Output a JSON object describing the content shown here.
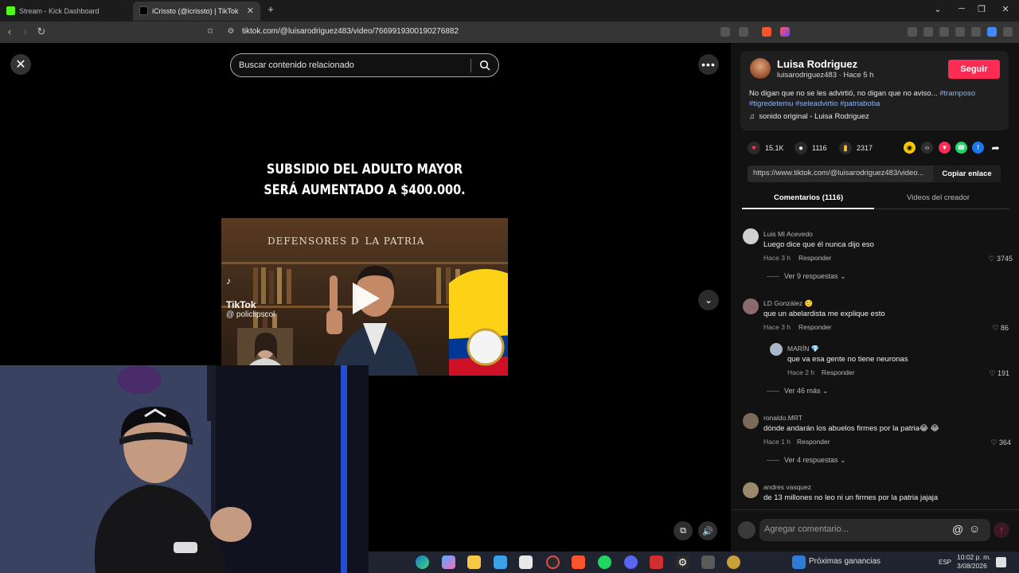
{
  "browser": {
    "tabs": [
      {
        "title": "Stream - Kick Dashboard",
        "favicon_color": "#53fc18"
      },
      {
        "title": "iCrissto (@icrissto) | TikTok",
        "close": "✕"
      }
    ],
    "new_tab": "+",
    "window_controls": {
      "minimize": "─",
      "restore": "❐",
      "close": "✕",
      "chevron": "⌄"
    },
    "nav": {
      "back": "‹",
      "forward": "›",
      "reload": "↻"
    },
    "url": "tiktok.com/@luisarodriguez483/video/7669919300190276882"
  },
  "video": {
    "search_placeholder": "Buscar contenido relacionado",
    "headline_line1": "SUBSIDIO DEL ADULTO MAYOR",
    "headline_line2": "SERÁ AUMENTADO A $400.000.",
    "clip_banner": "DEFENSORES D LA PATRIA",
    "watermark_logo": "♪",
    "watermark_name": "TikTok",
    "watermark_handle": "@ policlipscol",
    "close_icon": "✕",
    "more_icon": "•••",
    "down_icon": "⌄",
    "controls": {
      "pip": "⧉",
      "volume": "🔊"
    }
  },
  "taskbar": {
    "earnings": "Próximas ganancias",
    "lang": "ESP",
    "time": "10:02 p. m.",
    "date": "3/08/2026"
  },
  "author": {
    "name": "Luisa Rodriguez",
    "meta": "luisarodriguez483 · Hace 5 h",
    "follow": "Seguir",
    "description": "No digan que no se les advirtió, no digan que no aviso...",
    "tags": [
      "#tramposo",
      "#tigredetemu",
      "#seleadvirtio",
      "#patriaboba"
    ],
    "sound": "sonido original - Luisa Rodriguez",
    "sound_icon": "♫"
  },
  "stats": {
    "likes": "15.1K",
    "comments": "1116",
    "saves": "2317"
  },
  "share": {
    "link": "https://www.tiktok.com/@luisarodriguez483/video...",
    "copy": "Copiar enlace"
  },
  "panel_tabs": {
    "comments": "Comentarios (1116)",
    "creator_videos": "Videos del creador"
  },
  "comments": [
    {
      "user": "Luis Mi Acevedo",
      "text": "Luego dice que él nunca dijo eso",
      "time": "Hace 3 h",
      "reply": "Responder",
      "likes": "3745",
      "more": "Ver 9 respuestas"
    },
    {
      "user": "LD González 🙂",
      "text": "que un abelardista me explique esto",
      "time": "Hace 3 h",
      "reply": "Responder",
      "likes": "86"
    },
    {
      "user": "MARÍN 💎",
      "text": "que va esa gente no tiene neuronas",
      "time": "Hace 2 h",
      "reply": "Responder",
      "likes": "191",
      "more": "Ver 46 más"
    },
    {
      "user": "ronaldo.MRT",
      "text": "dónde andarán los abuelos firmes por la patria😂 😂",
      "time": "Hace 1 h",
      "reply": "Responder",
      "likes": "364",
      "more": "Ver 4 respuestas"
    },
    {
      "user": "andres vasquez",
      "text": "de 13 millones no leo ni un firmes por la patria jajaja"
    }
  ],
  "comment_bar": {
    "placeholder": "Agregar comentario...",
    "at": "@",
    "emoji": "☺",
    "send": "↑"
  },
  "colors": {
    "accent": "#fe2c55",
    "tag": "#8ab4f8",
    "panel": "#121212"
  }
}
